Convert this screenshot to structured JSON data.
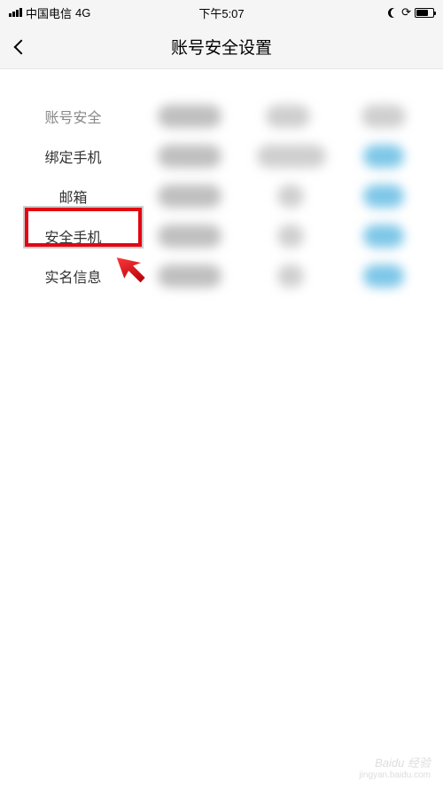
{
  "status_bar": {
    "carrier": "中国电信",
    "network": "4G",
    "time": "下午5:07"
  },
  "nav": {
    "title": "账号安全设置"
  },
  "rows": {
    "header": "账号安全",
    "bind_phone": "绑定手机",
    "email": "邮箱",
    "security_phone": "安全手机",
    "realname": "实名信息"
  },
  "watermark": {
    "brand": "Baidu 经验",
    "url": "jingyan.baidu.com"
  },
  "annotation": {
    "highlighted_item": "安全手机",
    "highlight_color": "#e30613"
  }
}
